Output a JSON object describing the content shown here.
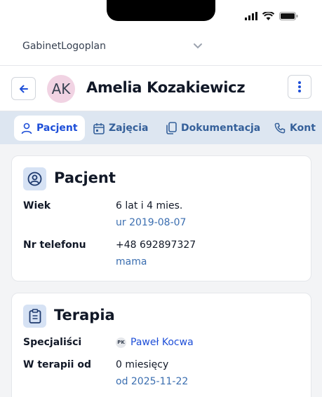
{
  "clinic": {
    "name": "GabinetLogoplan"
  },
  "patient": {
    "initials": "AK",
    "name": "Amelia Kozakiewicz"
  },
  "tabs": [
    {
      "label": "Pacjent",
      "icon": "user-icon"
    },
    {
      "label": "Zajęcia",
      "icon": "calendar-icon"
    },
    {
      "label": "Dokumentacja",
      "icon": "documents-icon"
    },
    {
      "label": "Kont",
      "icon": "phone-icon"
    }
  ],
  "patient_card": {
    "title": "Pacjent",
    "age_label": "Wiek",
    "age_value": "6 lat i 4 mies.",
    "birth_date": "ur 2019-08-07",
    "phone_label": "Nr telefonu",
    "phone_value": "+48 692897327",
    "phone_owner": "mama"
  },
  "therapy_card": {
    "title": "Terapia",
    "specialists_label": "Specjaliści",
    "specialist_initials": "PK",
    "specialist_name": "Paweł Kocwa",
    "duration_label": "W terapii od",
    "duration_value": "0 miesięcy",
    "start_date": "od 2025-11-22"
  },
  "colors": {
    "accent": "#1d4ed8",
    "tab_bar": "#dde6f1",
    "avatar_bg": "#f1d3e3"
  }
}
